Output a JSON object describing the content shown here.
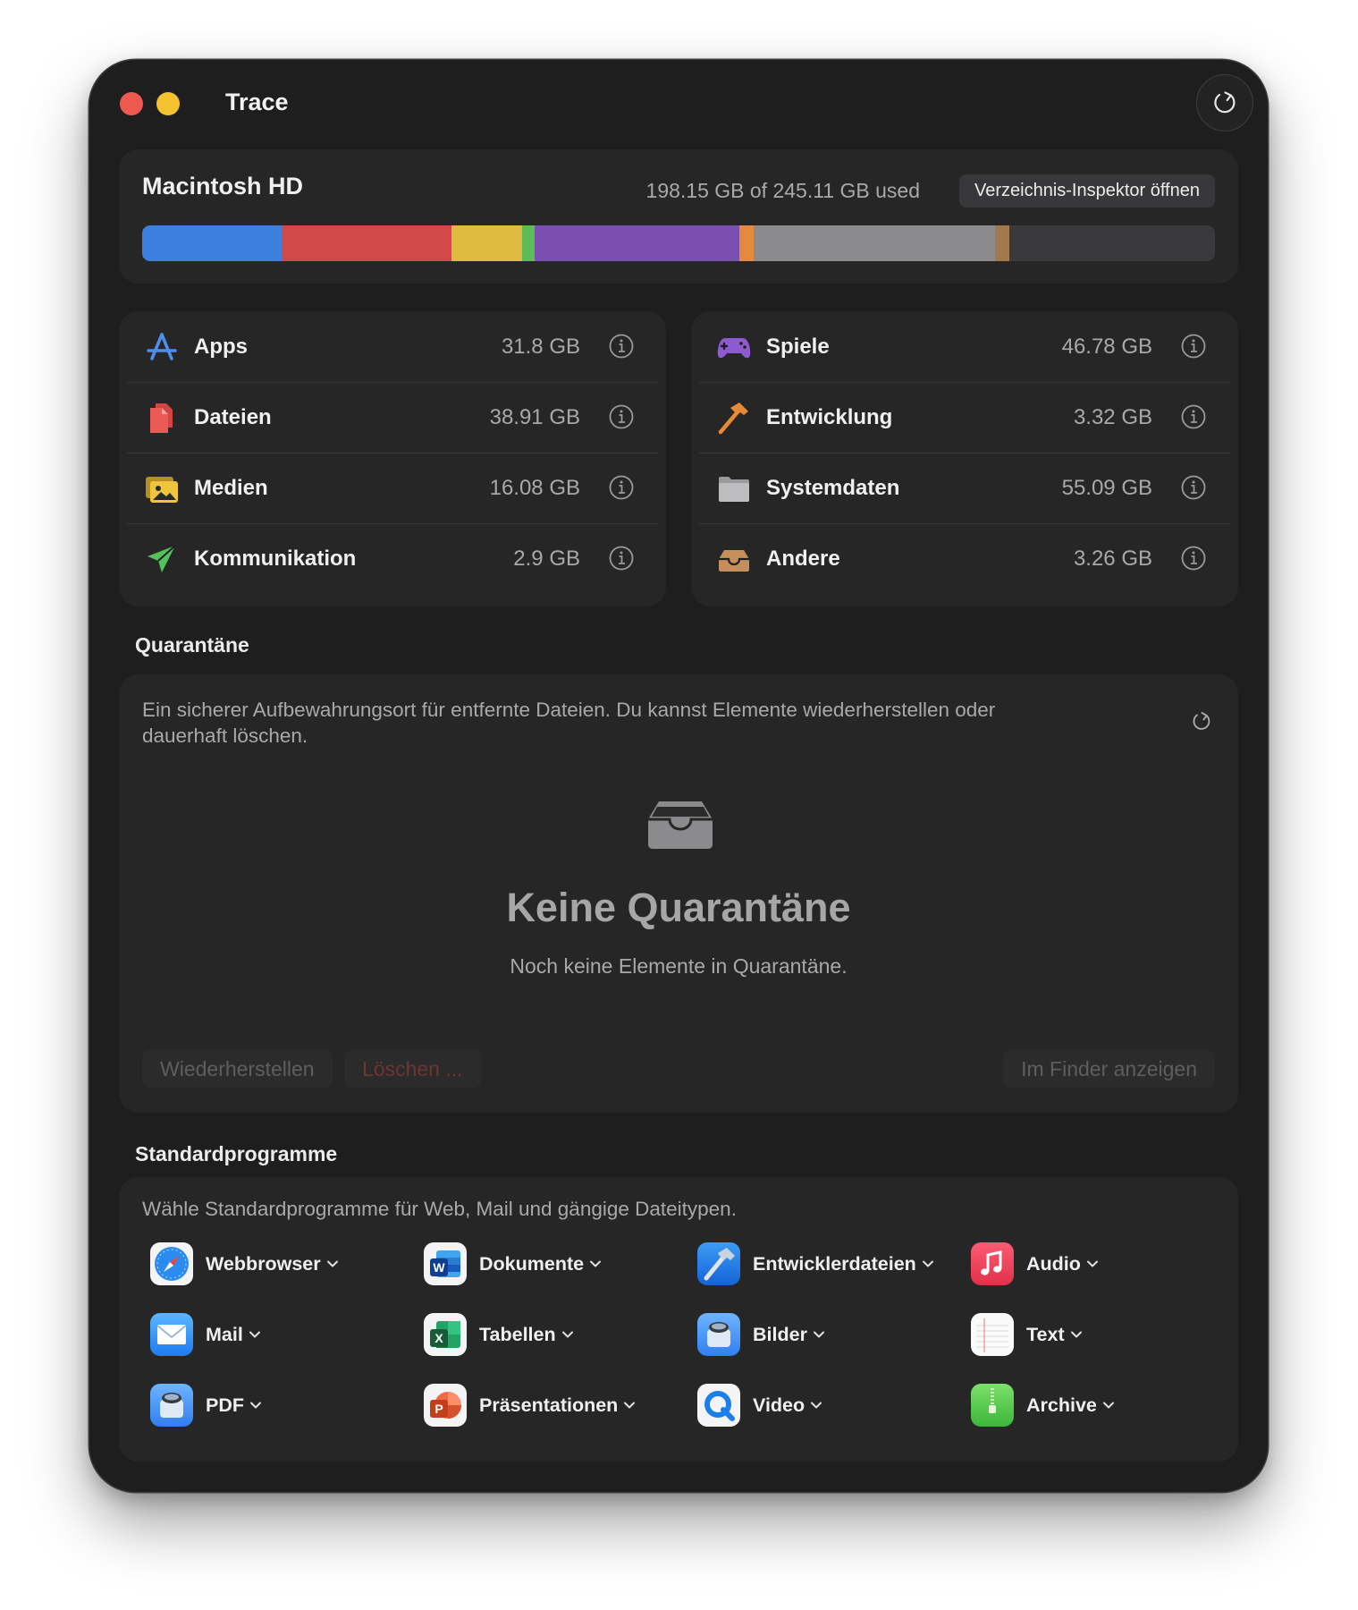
{
  "window": {
    "title": "Trace"
  },
  "disk": {
    "name": "Macintosh HD",
    "usage": "198.15 GB of 245.11 GB used",
    "inspector_button": "Verzeichnis-Inspektor öffnen",
    "segments": [
      {
        "label": "Apps",
        "size_gb": 31.8,
        "color": "#3d7fdd"
      },
      {
        "label": "Dateien",
        "size_gb": 38.91,
        "color": "#d3494a"
      },
      {
        "label": "Medien",
        "size_gb": 16.08,
        "color": "#dfbb40"
      },
      {
        "label": "Kommunikation",
        "size_gb": 2.9,
        "color": "#5dbb58"
      },
      {
        "label": "Spiele",
        "size_gb": 46.78,
        "color": "#7b4fb0"
      },
      {
        "label": "Entwicklung",
        "size_gb": 3.32,
        "color": "#e48a3c"
      },
      {
        "label": "Systemdaten",
        "size_gb": 55.09,
        "color": "#8b8b8d"
      },
      {
        "label": "Andere",
        "size_gb": 3.26,
        "color": "#a2784e"
      }
    ],
    "total_gb": 245.11
  },
  "categories": {
    "left": [
      {
        "label": "Apps",
        "size": "31.8 GB",
        "icon": "app-store-icon"
      },
      {
        "label": "Dateien",
        "size": "38.91 GB",
        "icon": "documents-icon"
      },
      {
        "label": "Medien",
        "size": "16.08 GB",
        "icon": "photos-icon"
      },
      {
        "label": "Kommunikation",
        "size": "2.9 GB",
        "icon": "paper-plane-icon"
      }
    ],
    "right": [
      {
        "label": "Spiele",
        "size": "46.78 GB",
        "icon": "gamecontroller-icon"
      },
      {
        "label": "Entwicklung",
        "size": "3.32 GB",
        "icon": "hammer-icon"
      },
      {
        "label": "Systemdaten",
        "size": "55.09 GB",
        "icon": "folder-icon"
      },
      {
        "label": "Andere",
        "size": "3.26 GB",
        "icon": "tray-icon"
      }
    ]
  },
  "quarantine": {
    "section_title": "Quarantäne",
    "description": "Ein sicherer Aufbewahrungsort für entfernte Dateien. Du kannst Elemente wiederherstellen oder dauerhaft löschen.",
    "empty_title": "Keine Quarantäne",
    "empty_subtitle": "Noch keine Elemente in Quarantäne.",
    "restore_button": "Wiederherstellen",
    "delete_button": "Löschen ...",
    "finder_button": "Im Finder anzeigen"
  },
  "default_apps": {
    "section_title": "Standardprogramme",
    "description": "Wähle Standardprogramme für Web, Mail und gängige Dateitypen.",
    "items": [
      {
        "label": "Webbrowser",
        "icon": "safari-icon"
      },
      {
        "label": "Dokumente",
        "icon": "word-icon"
      },
      {
        "label": "Entwicklerdateien",
        "icon": "xcode-icon"
      },
      {
        "label": "Audio",
        "icon": "music-icon"
      },
      {
        "label": "Mail",
        "icon": "mail-icon"
      },
      {
        "label": "Tabellen",
        "icon": "excel-icon"
      },
      {
        "label": "Bilder",
        "icon": "preview-icon"
      },
      {
        "label": "Text",
        "icon": "textedit-icon"
      },
      {
        "label": "PDF",
        "icon": "preview-icon"
      },
      {
        "label": "Präsentationen",
        "icon": "powerpoint-icon"
      },
      {
        "label": "Video",
        "icon": "quicktime-icon"
      },
      {
        "label": "Archive",
        "icon": "archive-utility-icon"
      }
    ]
  }
}
